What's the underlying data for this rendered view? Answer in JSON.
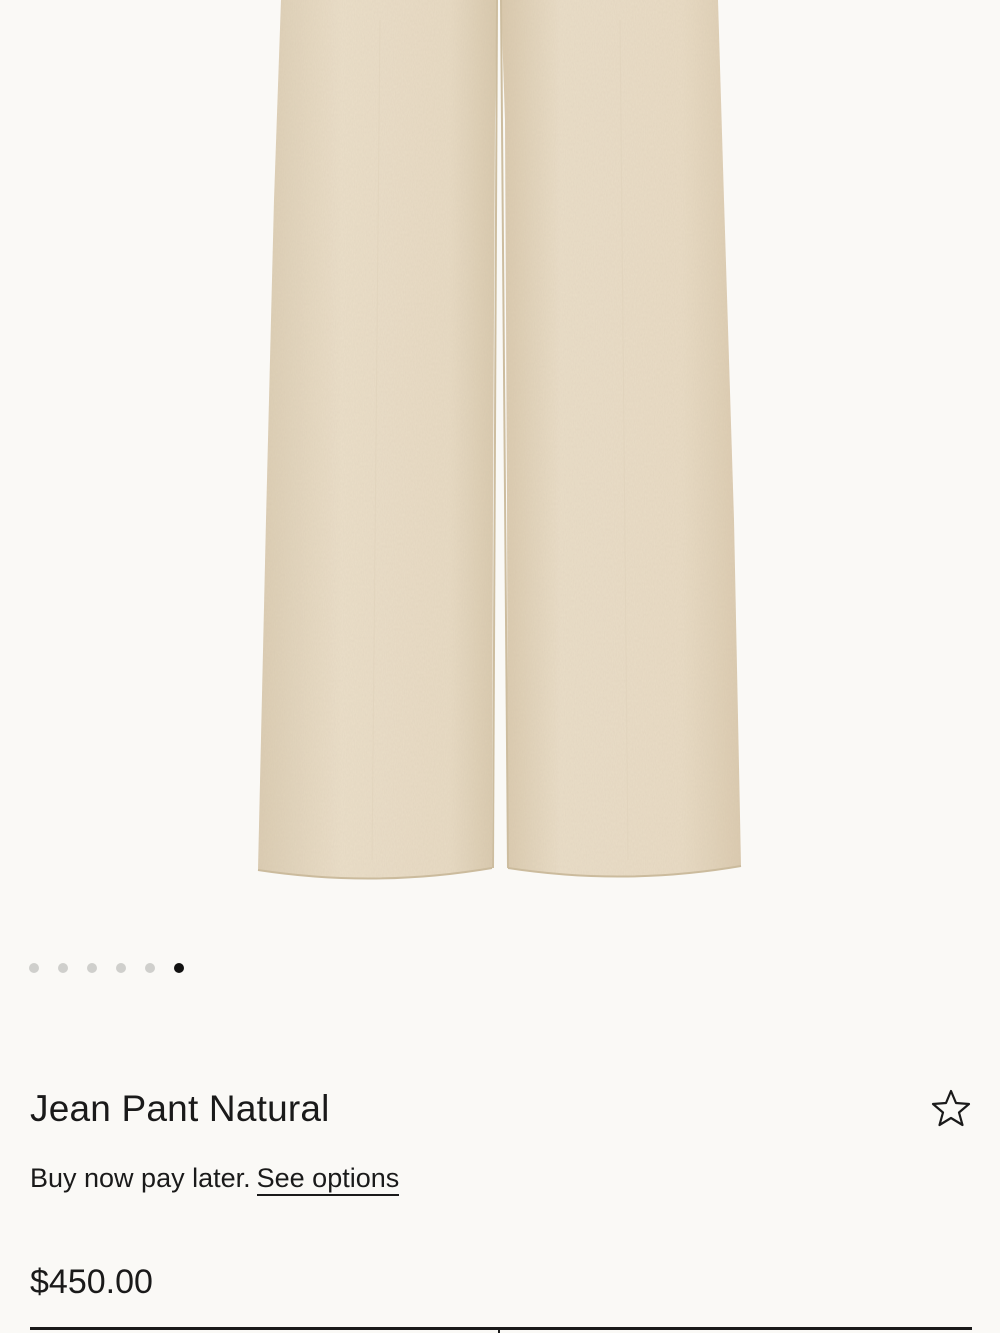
{
  "gallery": {
    "image_alt": "Jean Pant Natural",
    "slide_count": 6,
    "active_slide": 6
  },
  "product": {
    "title": "Jean Pant Natural",
    "favorite_icon": "star-outline-icon",
    "bnpl_text": "Buy now pay later.",
    "bnpl_link": "See options",
    "price": "$450.00"
  },
  "colors": {
    "background": "#faf9f6",
    "fabric": "#e9dcc5",
    "text": "#1a1a1a",
    "dot_inactive": "#cfcfcc",
    "dot_active": "#111111"
  }
}
